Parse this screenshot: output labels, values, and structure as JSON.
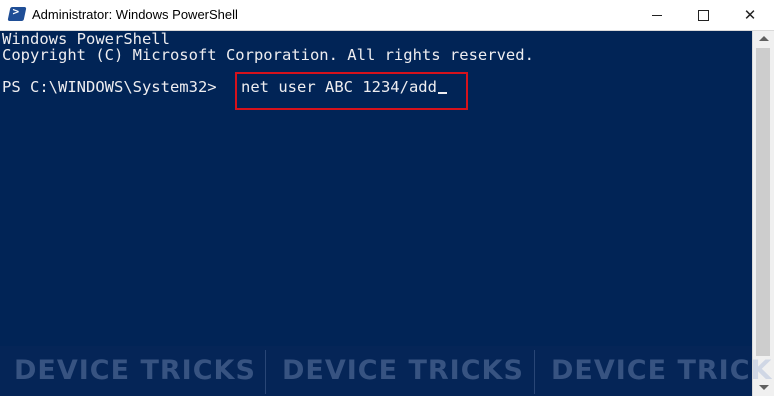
{
  "window": {
    "title": "Administrator: Windows PowerShell",
    "icon": "powershell-icon",
    "close_glyph": "✕"
  },
  "console": {
    "banner_line1": "Windows PowerShell",
    "banner_line2": "Copyright (C) Microsoft Corporation. All rights reserved.",
    "prompt": "PS C:\\WINDOWS\\System32>",
    "command": "net user ABC 1234/add",
    "background_color": "#012456",
    "highlight_color": "#d6121c"
  },
  "watermark": {
    "text": "DEVICE TRICKS"
  }
}
